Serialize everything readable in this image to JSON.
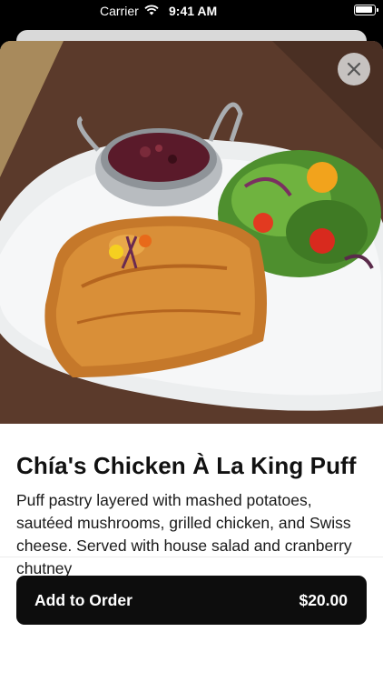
{
  "status_bar": {
    "carrier": "Carrier",
    "time": "9:41 AM"
  },
  "item": {
    "image_icon": "food-photo",
    "name": "Chía's Chicken À La King Puff",
    "description": "Puff pastry layered with mashed potatoes, sautéed mushrooms, grilled chicken, and Swiss cheese. Served with house salad and cranberry chutney"
  },
  "actions": {
    "close_icon": "close-icon",
    "add_label": "Add to Order",
    "price": "$20.00"
  }
}
